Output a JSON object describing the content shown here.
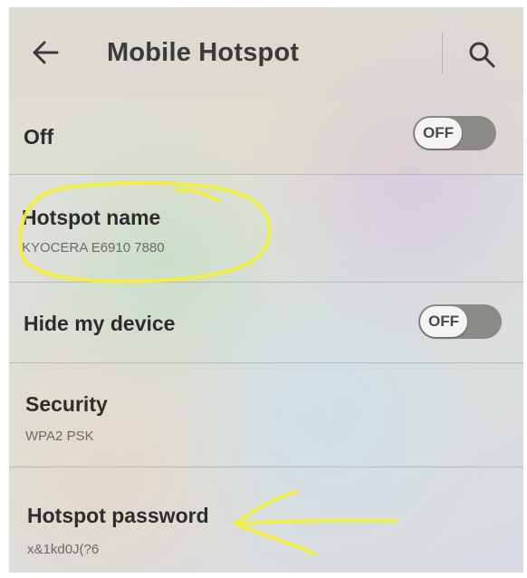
{
  "header": {
    "title": "Mobile Hotspot",
    "back_icon": "arrow-left-icon",
    "search_icon": "search-icon"
  },
  "master_switch": {
    "label": "Off",
    "toggle_text": "OFF",
    "state": "off"
  },
  "hotspot_name": {
    "title": "Hotspot name",
    "value": "KYOCERA E6910 7880"
  },
  "hide_device": {
    "title": "Hide my device",
    "toggle_text": "OFF",
    "state": "off"
  },
  "security": {
    "title": "Security",
    "value": "WPA2 PSK"
  },
  "password": {
    "title": "Hotspot password",
    "value": "x&1kd0J(?6"
  },
  "colors": {
    "annotation": "#f2ee3c",
    "toggle_track": "#8a8a86"
  }
}
